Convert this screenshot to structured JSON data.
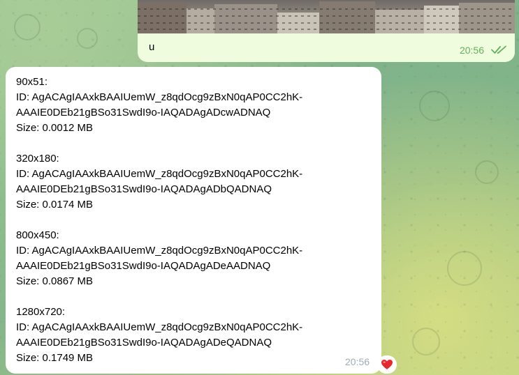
{
  "outgoing": {
    "caption": "u",
    "time": "20:56"
  },
  "incoming": {
    "blocks": [
      {
        "dims": "90x51:",
        "id_line1": "ID: AgACAgIAAxkBAAIUemW_z8qdOcg9zBxN0qAP0CC2hK-",
        "id_line2": "AAAIE0DEb21gBSo31SwdI9o-IAQADAgADcwADNAQ",
        "size": "Size: 0.0012 MB"
      },
      {
        "dims": "320x180:",
        "id_line1": "ID: AgACAgIAAxkBAAIUemW_z8qdOcg9zBxN0qAP0CC2hK-",
        "id_line2": "AAAIE0DEb21gBSo31SwdI9o-IAQADAgADbQADNAQ",
        "size": "Size: 0.0174 MB"
      },
      {
        "dims": "800x450:",
        "id_line1": "ID: AgACAgIAAxkBAAIUemW_z8qdOcg9zBxN0qAP0CC2hK-",
        "id_line2": "AAAIE0DEb21gBSo31SwdI9o-IAQADAgADeAADNAQ",
        "size": "Size: 0.0867 MB"
      },
      {
        "dims": "1280x720:",
        "id_line1": "ID: AgACAgIAAxkBAAIUemW_z8qdOcg9zBxN0qAP0CC2hK-",
        "id_line2": "AAAIE0DEb21gBSo31SwdI9o-IAQADAgADeQADNAQ",
        "size": "Size: 0.1749 MB"
      }
    ],
    "time": "20:56",
    "reaction_icon": "red-heart-icon"
  },
  "colors": {
    "outgoing_bubble": "#effdde",
    "incoming_bubble": "#ffffff",
    "outgoing_time": "#5fb35a",
    "incoming_time": "#a0acb6",
    "heart": "#e8262e"
  }
}
